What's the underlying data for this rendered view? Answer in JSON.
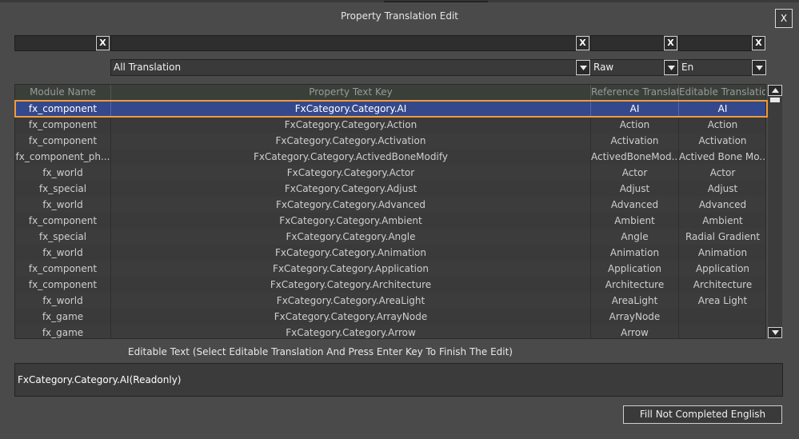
{
  "dialog": {
    "title": "Property Translation Edit",
    "close_label": "X"
  },
  "filters": {
    "clear_label": "X",
    "module_value": "",
    "key_value": "",
    "reference_value": "",
    "editable_value": ""
  },
  "combos": {
    "translation_scope": "All Translation",
    "reference_language": "Raw",
    "editable_language": "En"
  },
  "table": {
    "columns": [
      "Module Name",
      "Property Text Key",
      "Reference Translation",
      "Editable Translation"
    ],
    "selected_index": 0,
    "rows": [
      [
        "fx_component",
        "FxCategory.Category.AI",
        "AI",
        "AI"
      ],
      [
        "fx_component",
        "FxCategory.Category.Action",
        "Action",
        "Action"
      ],
      [
        "fx_component",
        "FxCategory.Category.Activation",
        "Activation",
        "Activation"
      ],
      [
        "fx_component_ph...",
        "FxCategory.Category.ActivedBoneModify",
        "ActivedBoneMod...",
        "Actived Bone Mo..."
      ],
      [
        "fx_world",
        "FxCategory.Category.Actor",
        "Actor",
        "Actor"
      ],
      [
        "fx_special",
        "FxCategory.Category.Adjust",
        "Adjust",
        "Adjust"
      ],
      [
        "fx_world",
        "FxCategory.Category.Advanced",
        "Advanced",
        "Advanced"
      ],
      [
        "fx_component",
        "FxCategory.Category.Ambient",
        "Ambient",
        "Ambient"
      ],
      [
        "fx_special",
        "FxCategory.Category.Angle",
        "Angle",
        "Radial Gradient"
      ],
      [
        "fx_world",
        "FxCategory.Category.Animation",
        "Animation",
        "Animation"
      ],
      [
        "fx_component",
        "FxCategory.Category.Application",
        "Application",
        "Application"
      ],
      [
        "fx_component",
        "FxCategory.Category.Architecture",
        "Architecture",
        "Architecture"
      ],
      [
        "fx_world",
        "FxCategory.Category.AreaLight",
        "AreaLight",
        "Area Light"
      ],
      [
        "fx_game",
        "FxCategory.Category.ArrayNode",
        "ArrayNode",
        ""
      ],
      [
        "fx_game",
        "FxCategory.Category.Arrow",
        "Arrow",
        ""
      ]
    ]
  },
  "editor": {
    "label": "Editable Text (Select Editable Translation And Press Enter Key To Finish The Edit)",
    "value": "FxCategory.Category.AI(Readonly)"
  },
  "actions": {
    "fill_label": "Fill Not Completed English"
  },
  "colors": {
    "background": "#4a4a4a",
    "selection": "#34488c",
    "focus_outline": "#f29a38"
  }
}
